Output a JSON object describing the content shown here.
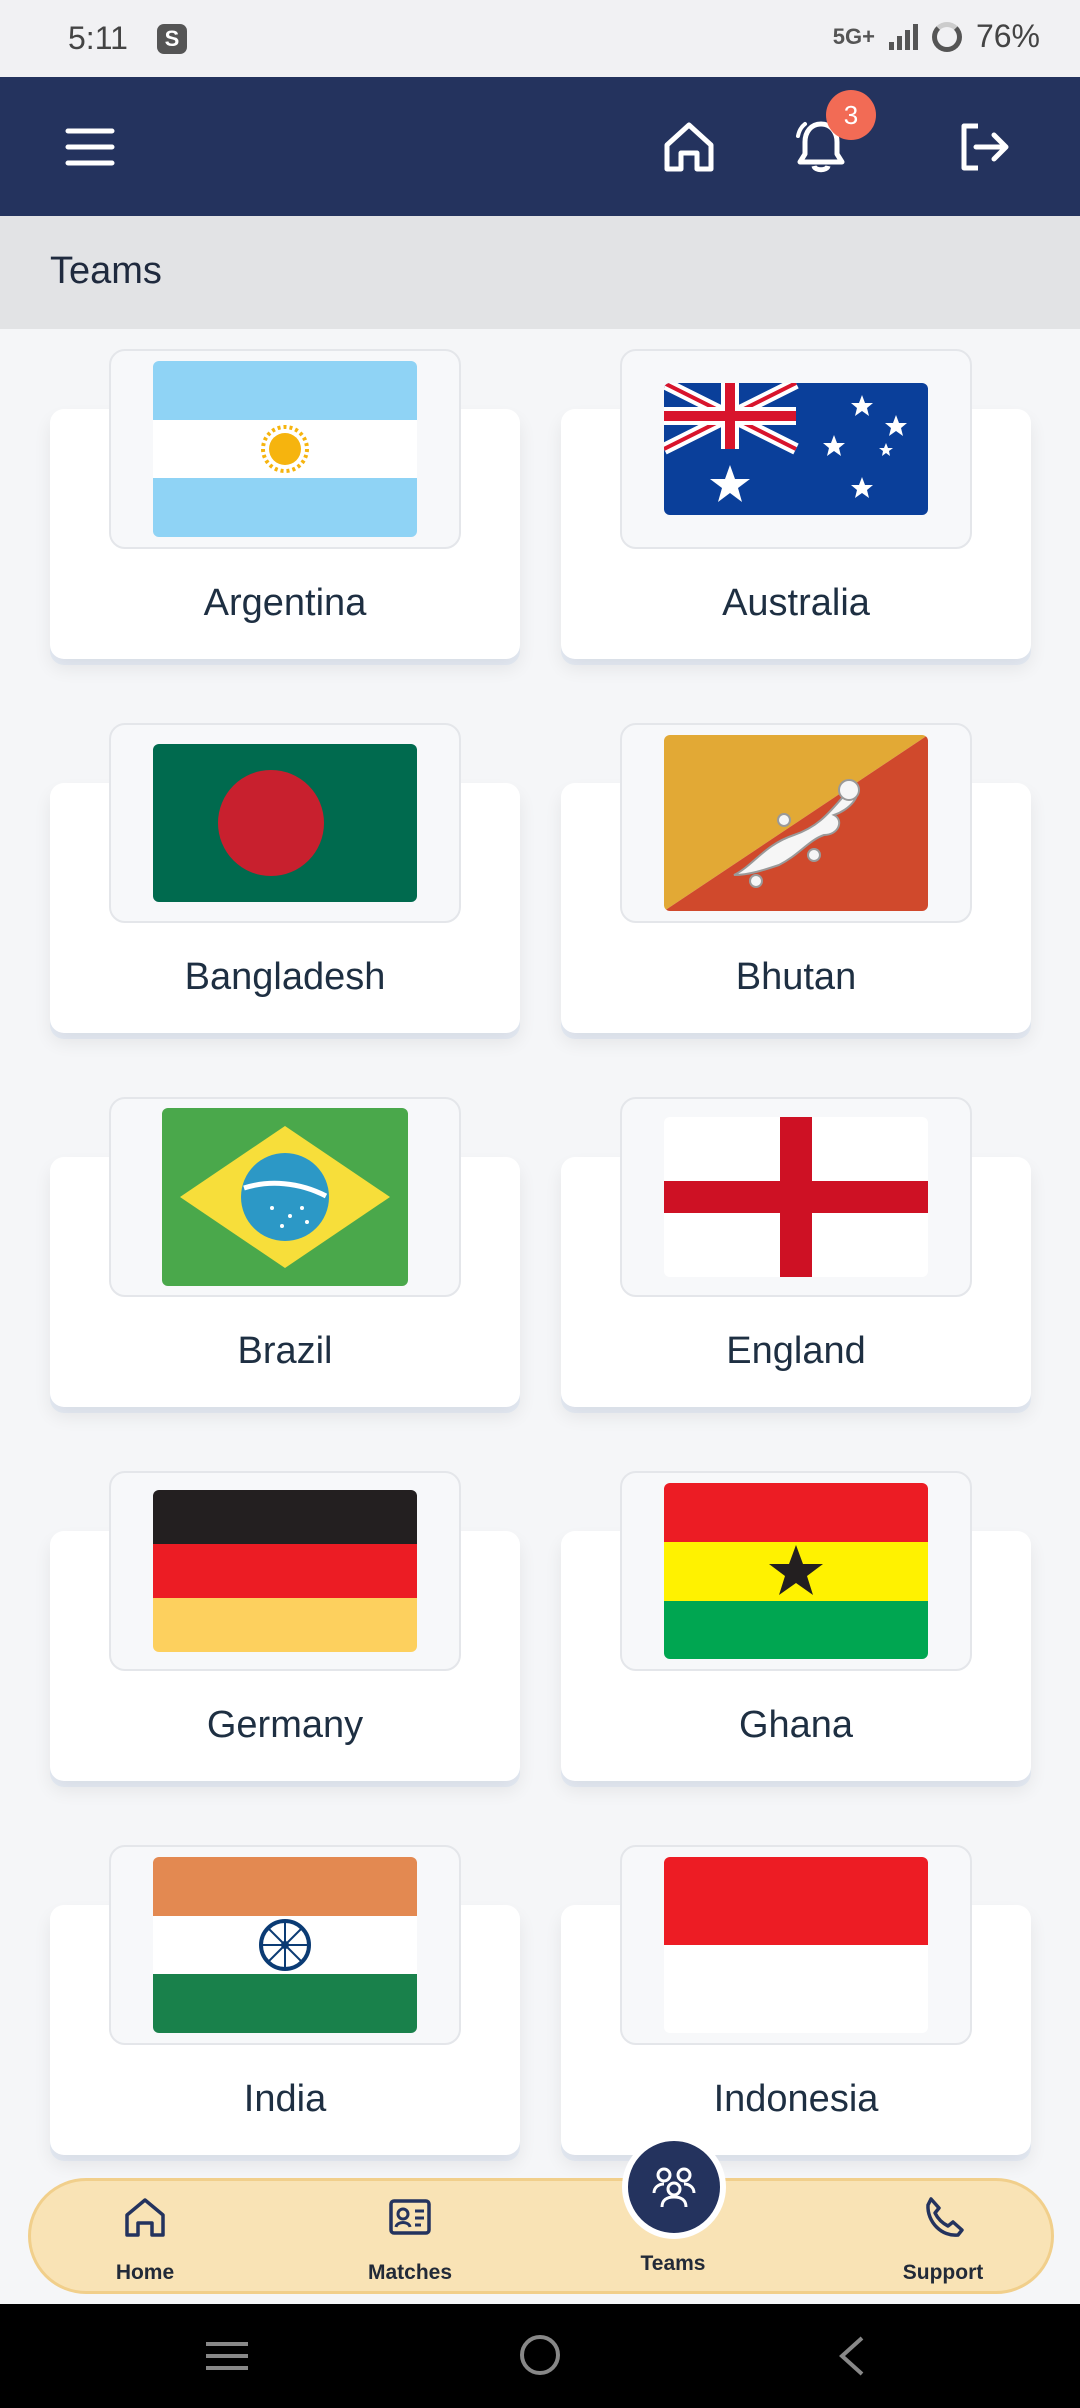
{
  "status_bar": {
    "time": "5:11",
    "app_icon": "S",
    "network": "5G+",
    "battery": "76%"
  },
  "app_bar": {
    "notification_count": "3",
    "icons": [
      "menu-icon",
      "home-icon",
      "bell-icon",
      "logout-icon"
    ],
    "color": "#24335e"
  },
  "page": {
    "title": "Teams"
  },
  "teams": [
    {
      "name": "Argentina"
    },
    {
      "name": "Australia"
    },
    {
      "name": "Bangladesh"
    },
    {
      "name": "Bhutan"
    },
    {
      "name": "Brazil"
    },
    {
      "name": "England"
    },
    {
      "name": "Germany"
    },
    {
      "name": "Ghana"
    },
    {
      "name": "India"
    },
    {
      "name": "Indonesia"
    }
  ],
  "bottom_nav": {
    "items": [
      {
        "label": "Home",
        "icon": "home-icon"
      },
      {
        "label": "Matches",
        "icon": "id-card-icon"
      },
      {
        "label": "Teams",
        "icon": "people-icon",
        "active": true
      },
      {
        "label": "Support",
        "icon": "phone-icon"
      }
    ],
    "background": "#f9e3b5"
  }
}
